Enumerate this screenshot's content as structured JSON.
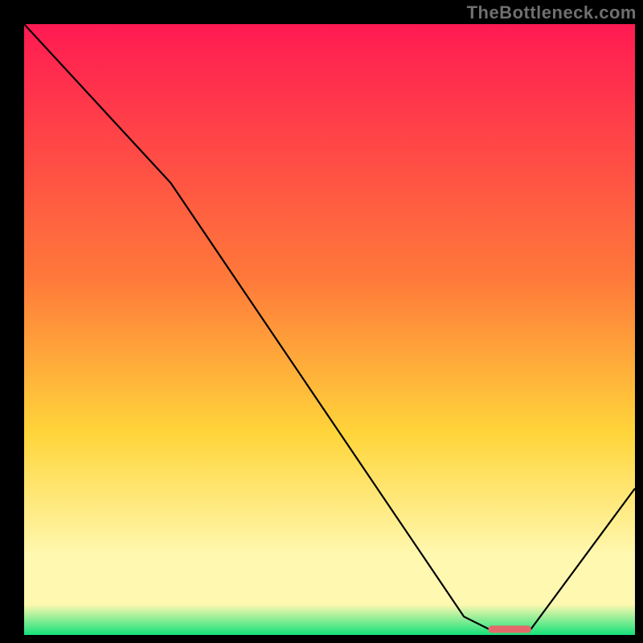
{
  "watermark": "TheBottleneck.com",
  "colors": {
    "top": "#ff1a52",
    "mid1": "#ff7a3a",
    "mid2": "#ffd53a",
    "mid3": "#fff8b0",
    "bottom": "#14e27a",
    "curve": "#000000",
    "marker": "#e46a6a",
    "background": "#000000"
  },
  "chart_data": {
    "type": "line",
    "title": "",
    "xlabel": "",
    "ylabel": "",
    "xlim": [
      0,
      100
    ],
    "ylim": [
      0,
      100
    ],
    "series": [
      {
        "name": "bottleneck-curve",
        "x": [
          0,
          24,
          72,
          76,
          83,
          100
        ],
        "y": [
          100,
          74,
          3,
          1,
          1,
          24
        ]
      }
    ],
    "optimal_marker": {
      "x_start": 76,
      "x_end": 83,
      "y": 1
    },
    "gradient_stops_pct": [
      0,
      42,
      67,
      87,
      95,
      100
    ]
  }
}
